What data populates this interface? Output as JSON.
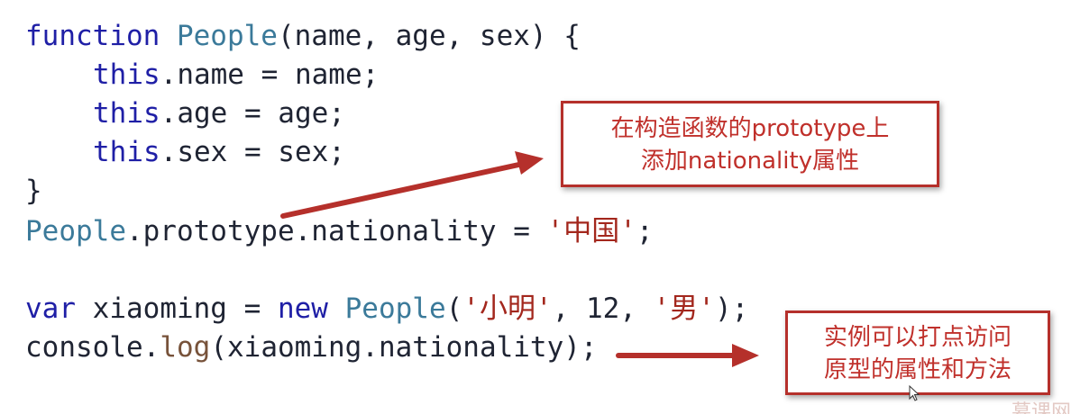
{
  "code": {
    "line1": {
      "keyword": "function",
      "name": "People",
      "params": "(name, age, sex) {"
    },
    "line2": {
      "this": "this",
      "rest": ".name = name;"
    },
    "line3": {
      "this": "this",
      "rest": ".age = age;"
    },
    "line4": {
      "this": "this",
      "rest": ".sex = sex;"
    },
    "line5": {
      "text": "}"
    },
    "line6": {
      "object": "People",
      "rest": ".prototype.nationality = ",
      "string": "'中国'",
      "end": ";"
    },
    "line8": {
      "keyword": "var",
      "rest": " xiaoming = ",
      "new": "new",
      "space": " ",
      "class": "People",
      "open": "(",
      "string1": "'小明'",
      "sep1": ", ",
      "number": "12",
      "sep2": ", ",
      "string2": "'男'",
      "close": ");"
    },
    "line9": {
      "object": "console",
      "dot": ".",
      "method": "log",
      "rest": "(xiaoming.nationality);"
    }
  },
  "callouts": {
    "top": {
      "line1": "在构造函数的prototype上",
      "line2": "添加nationality属性"
    },
    "bottom": {
      "line1": "实例可以打点访问",
      "line2": "原型的属性和方法"
    }
  },
  "watermark": "慕课网",
  "colors": {
    "keyword": "#1f1fa6",
    "class_name": "#3b7a9a",
    "string": "#a3271d",
    "callout_border": "#b5302b",
    "arrow": "#b5302b"
  },
  "icons": {
    "cursor": "mouse-pointer-icon"
  }
}
